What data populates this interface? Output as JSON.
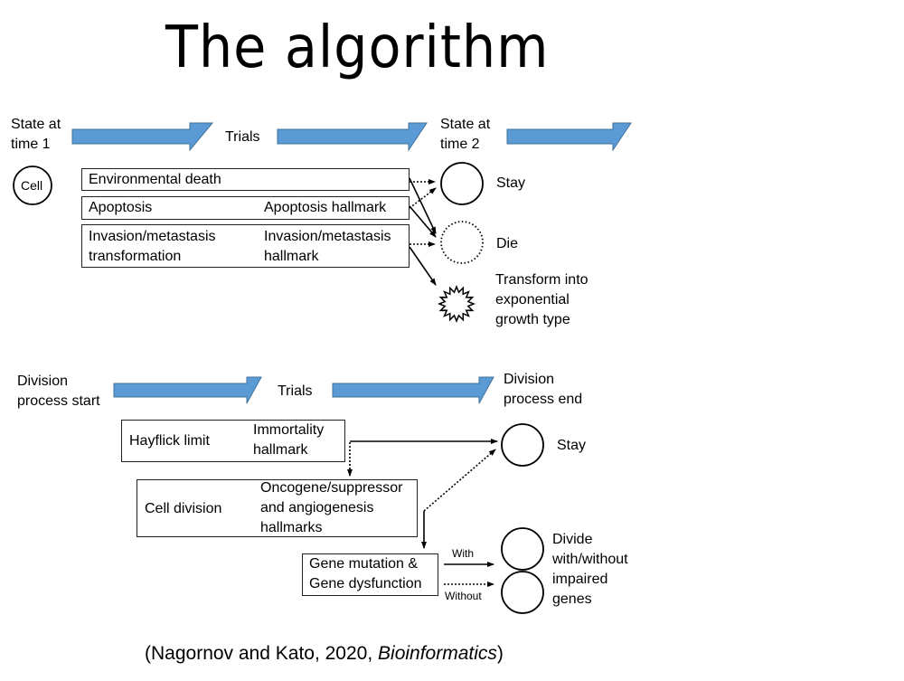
{
  "title": "The algorithm",
  "top_section": {
    "start_label": [
      "State at",
      "time 1"
    ],
    "trials_label": "Trials",
    "end_label": [
      "State at",
      "time 2"
    ],
    "cell_label": "Cell",
    "rows": [
      {
        "left": "Environmental death",
        "right": ""
      },
      {
        "left": "Apoptosis",
        "right": "Apoptosis hallmark"
      },
      {
        "left": [
          "Invasion/metastasis",
          "transformation"
        ],
        "right": [
          "Invasion/metastasis",
          "hallmark"
        ]
      }
    ],
    "outcomes": {
      "stay": "Stay",
      "die": "Die",
      "transform": [
        "Transform into",
        "exponential",
        "growth type"
      ]
    }
  },
  "bottom_section": {
    "start_label": [
      "Division",
      "process start"
    ],
    "trials_label": "Trials",
    "end_label": [
      "Division",
      "process end"
    ],
    "hayflick": {
      "left": "Hayflick limit",
      "right": [
        "Immortality",
        "hallmark"
      ]
    },
    "cell_division": {
      "left": "Cell division",
      "right": [
        "Oncogene/suppressor",
        "and angiogenesis",
        "hallmarks"
      ]
    },
    "gene_box": [
      "Gene mutation &",
      "Gene dysfunction"
    ],
    "with_label": "With",
    "without_label": "Without",
    "stay": "Stay",
    "divide": [
      "Divide",
      "with/without",
      "impaired",
      "genes"
    ]
  },
  "citation": {
    "authors": "(Nagornov and Kato, 2020, ",
    "journal": "Bioinformatics",
    "close": ")"
  },
  "colors": {
    "blue_arrow": "#5b9bd5",
    "blue_arrow_edge": "#41719c",
    "red_arrow": "#ff0000",
    "red_arrow_edge": "#4472c4"
  }
}
